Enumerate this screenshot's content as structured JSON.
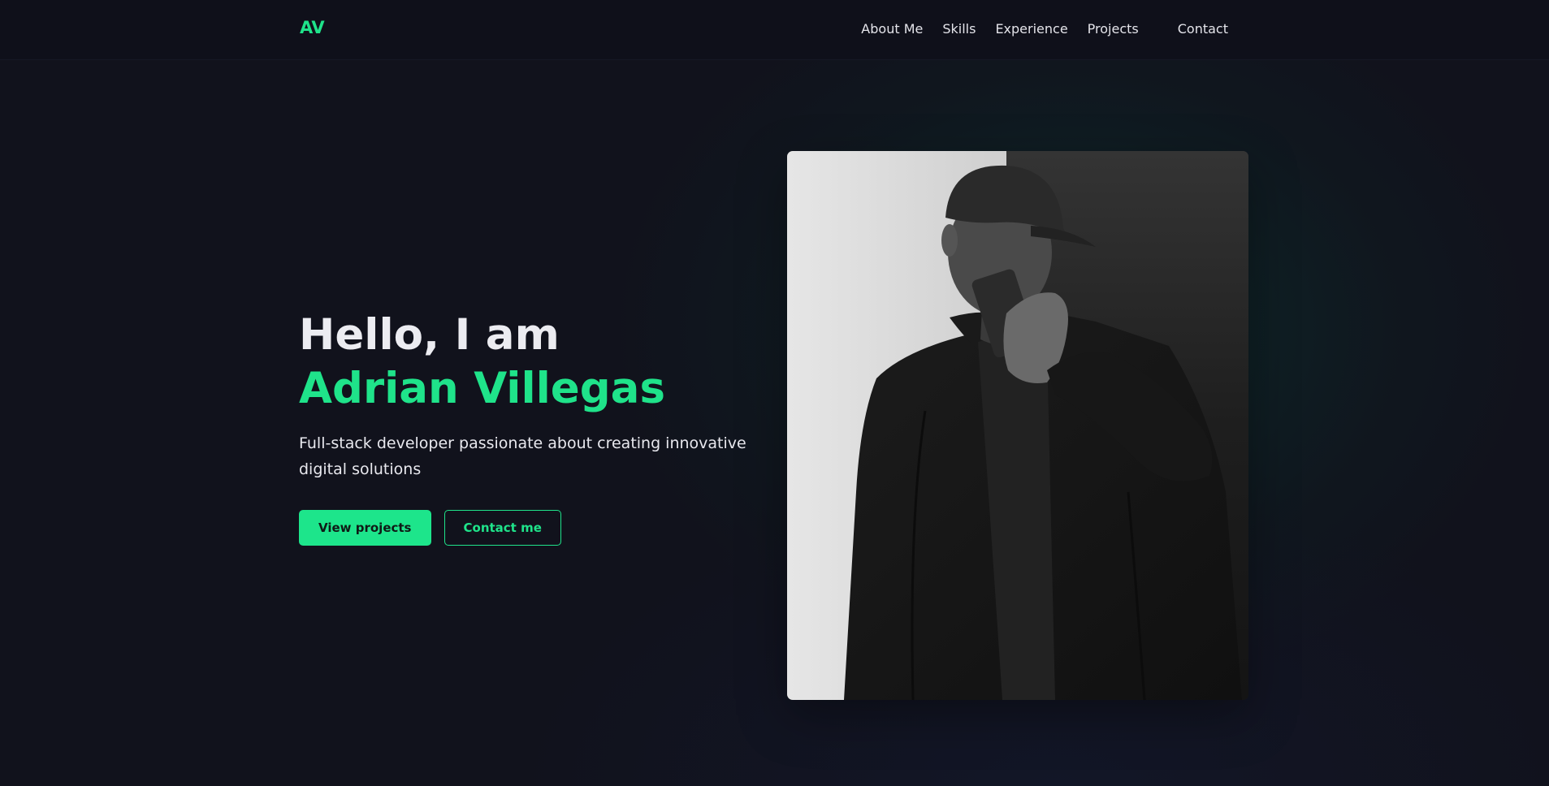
{
  "brand": {
    "logo": "AV",
    "accent_color": "#1fe38a"
  },
  "nav": {
    "items": [
      {
        "label": "About Me"
      },
      {
        "label": "Skills"
      },
      {
        "label": "Experience"
      },
      {
        "label": "Projects"
      },
      {
        "label": "Contact"
      }
    ]
  },
  "hero": {
    "greeting": "Hello, I am",
    "name": "Adrian Villegas",
    "tagline": "Full-stack developer passionate about creating innovative digital solutions",
    "primary_button": "View projects",
    "secondary_button": "Contact me"
  },
  "photo": {
    "subject": "profile-photo",
    "style": "black-and-white"
  }
}
